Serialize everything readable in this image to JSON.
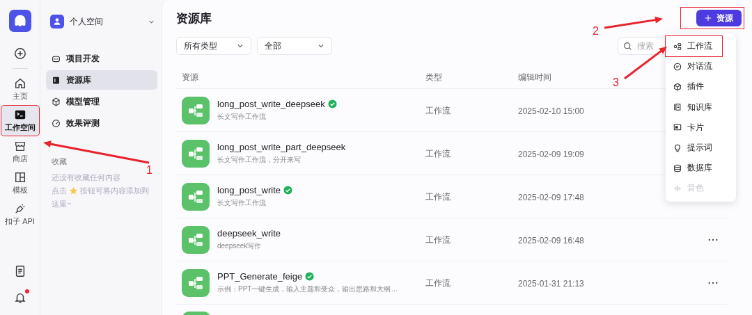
{
  "rail": {
    "items": [
      {
        "label": "主页",
        "selected": false,
        "annotated": false
      },
      {
        "label": "工作空间",
        "selected": true,
        "annotated": true
      },
      {
        "label": "商店",
        "selected": false,
        "annotated": false
      },
      {
        "label": "模板",
        "selected": false,
        "annotated": false
      },
      {
        "label": "扣子 API",
        "selected": false,
        "annotated": false
      }
    ],
    "notification_badge": true
  },
  "sidebar": {
    "workspace": "个人空间",
    "items": [
      {
        "label": "项目开发",
        "selected": false
      },
      {
        "label": "资源库",
        "selected": true
      },
      {
        "label": "模型管理",
        "selected": false
      },
      {
        "label": "效果评测",
        "selected": false
      }
    ],
    "favorites_title": "收藏",
    "favorites_empty": "还没有收藏任何内容",
    "favorites_hint": [
      "点击",
      "按钮可将内容添加到",
      "这里~"
    ]
  },
  "page": {
    "title": "资源库",
    "add_button": {
      "label": "资源",
      "annotated": true
    },
    "filters": [
      "所有类型",
      "全部"
    ],
    "search": {
      "placeholder": "搜索"
    }
  },
  "table": {
    "columns": [
      "资源",
      "类型",
      "编辑时间"
    ],
    "rows": [
      {
        "name": "long_post_write_deepseek",
        "verified": true,
        "description": "长文写作工作流",
        "type": "工作流",
        "edited": "2025-02-10 15:00",
        "more": false
      },
      {
        "name": "long_post_write_part_deepseek",
        "verified": false,
        "description": "长文写作工作流，分开来写",
        "type": "工作流",
        "edited": "2025-02-09 19:09",
        "more": false
      },
      {
        "name": "long_post_write",
        "verified": true,
        "description": "长文写作工作流",
        "type": "工作流",
        "edited": "2025-02-09 17:48",
        "more": false
      },
      {
        "name": "deepseek_write",
        "verified": false,
        "description": "deepseek写作",
        "type": "工作流",
        "edited": "2025-02-09 16:48",
        "more": true
      },
      {
        "name": "PPT_Generate_feige",
        "verified": true,
        "description": "示例：PPT一键生成，输入主题和受众，输出思路和大纲…",
        "type": "工作流",
        "edited": "2025-01-31 21:13",
        "more": true
      }
    ]
  },
  "add_menu": {
    "items": [
      {
        "label": "工作流",
        "disabled": false,
        "annotated": true
      },
      {
        "label": "对话流",
        "disabled": false,
        "annotated": false
      },
      {
        "label": "插件",
        "disabled": false,
        "annotated": false
      },
      {
        "label": "知识库",
        "disabled": false,
        "annotated": false
      },
      {
        "label": "卡片",
        "disabled": false,
        "annotated": false
      },
      {
        "label": "提示词",
        "disabled": false,
        "annotated": false
      },
      {
        "label": "数据库",
        "disabled": false,
        "annotated": false
      },
      {
        "label": "音色",
        "disabled": true,
        "annotated": false
      }
    ]
  },
  "annotations": [
    {
      "label": "1"
    },
    {
      "label": "2"
    },
    {
      "label": "3"
    }
  ]
}
